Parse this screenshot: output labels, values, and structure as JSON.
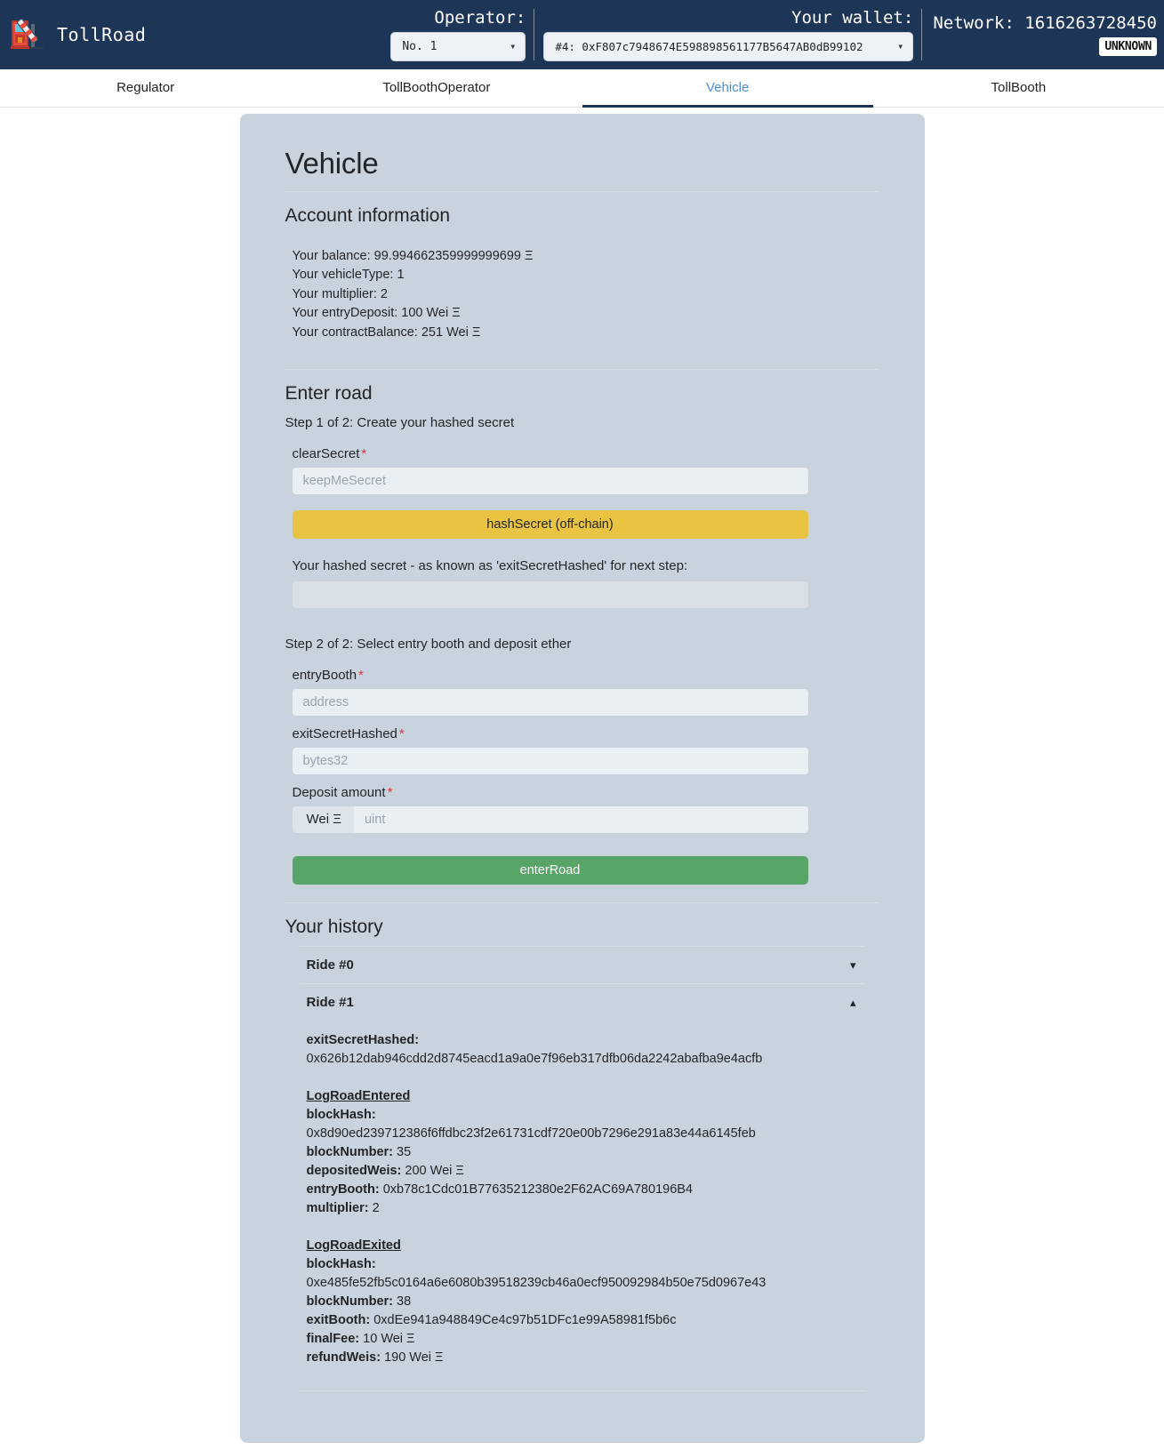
{
  "header": {
    "brand": "TollRoad",
    "brand_icon": "tollbooth-icon",
    "operator_label": "Operator:",
    "operator_value": "No. 1",
    "wallet_label": "Your wallet:",
    "wallet_value": "#4: 0xF807c7948674E598898561177B5647AB0dB99102",
    "network_label": "Network: 1616263728450",
    "network_badge": "UNKNOWN",
    "navbar_bg": "#1d3557"
  },
  "tabs": [
    {
      "label": "Regulator",
      "active": false
    },
    {
      "label": "TollBoothOperator",
      "active": false
    },
    {
      "label": "Vehicle",
      "active": true
    },
    {
      "label": "TollBooth",
      "active": false
    }
  ],
  "main": {
    "title": "Vehicle",
    "account": {
      "heading": "Account information",
      "lines": [
        "Your balance: 99.994662359999999699 Ξ",
        "Your vehicleType: 1",
        "Your multiplier: 2",
        "Your entryDeposit: 100 Wei Ξ",
        "Your contractBalance: 251 Wei Ξ"
      ]
    },
    "enter_road": {
      "heading": "Enter road",
      "step1_text": "Step 1 of 2: Create your hashed secret",
      "clear_secret_label": "clearSecret",
      "clear_secret_placeholder": "keepMeSecret",
      "clear_secret_value": "",
      "hash_button": "hashSecret (off-chain)",
      "hashed_secret_label": "Your hashed secret - as known as 'exitSecretHashed' for next step:",
      "hashed_secret_value": "",
      "step2_text": "Step 2 of 2: Select entry booth and deposit ether",
      "entry_booth_label": "entryBooth",
      "entry_booth_placeholder": "address",
      "entry_booth_value": "",
      "exit_secret_hashed_label": "exitSecretHashed",
      "exit_secret_hashed_placeholder": "bytes32",
      "exit_secret_hashed_value": "",
      "deposit_label": "Deposit amount",
      "deposit_addon": "Wei Ξ",
      "deposit_placeholder": "uint",
      "deposit_value": "",
      "required_marker": "*",
      "enter_road_button": "enterRoad"
    },
    "history": {
      "heading": "Your history",
      "rides": [
        {
          "title": "Ride #0",
          "expanded": false,
          "chevron": "chevron-down-icon"
        },
        {
          "title": "Ride #1",
          "expanded": true,
          "chevron": "chevron-up-icon",
          "exit_secret_hashed_key": "exitSecretHashed:",
          "exit_secret_hashed_val": "0x626b12dab946cdd2d8745eacd1a9a0e7f96eb317dfb06da2242abafba9e4acfb",
          "events": [
            {
              "name": "LogRoadEntered",
              "block_hash_key": "blockHash:",
              "block_hash_val": "0x8d90ed239712386f6ffdbc23f2e61731cdf720e00b7296e291a83e44a6145feb",
              "rows": [
                {
                  "key": "blockNumber:",
                  "val": "35"
                },
                {
                  "key": "depositedWeis:",
                  "val": "200 Wei Ξ"
                },
                {
                  "key": "entryBooth:",
                  "val": "0xb78c1Cdc01B77635212380e2F62AC69A780196B4"
                },
                {
                  "key": "multiplier:",
                  "val": "2"
                }
              ]
            },
            {
              "name": "LogRoadExited",
              "block_hash_key": "blockHash:",
              "block_hash_val": "0xe485fe52fb5c0164a6e6080b39518239cb46a0ecf950092984b50e75d0967e43",
              "rows": [
                {
                  "key": "blockNumber:",
                  "val": "38"
                },
                {
                  "key": "exitBooth:",
                  "val": "0xdEe941a948849Ce4c97b51DFc1e99A58981f5b6c"
                },
                {
                  "key": "finalFee:",
                  "val": "10 Wei Ξ"
                },
                {
                  "key": "refundWeis:",
                  "val": "190 Wei Ξ"
                }
              ]
            }
          ]
        }
      ]
    }
  },
  "colors": {
    "navbar": "#1d3557",
    "card": "#c9d3de",
    "accent": "#4a90d9",
    "warning": "#e9c342",
    "success": "#57a567",
    "required": "#dc3545"
  }
}
